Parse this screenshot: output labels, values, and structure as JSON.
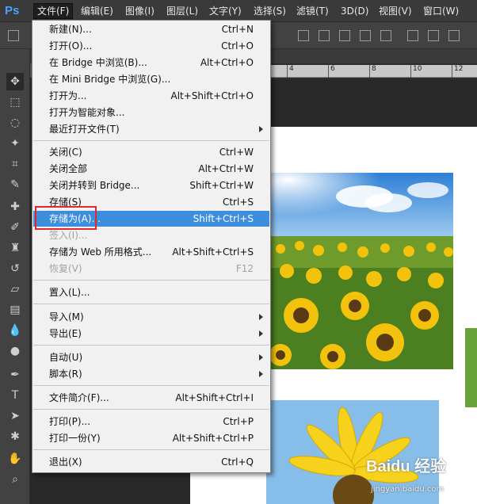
{
  "app": {
    "logo": "Ps"
  },
  "menubar": {
    "items": [
      {
        "label": "文件(F)",
        "active": true
      },
      {
        "label": "编辑(E)"
      },
      {
        "label": "图像(I)"
      },
      {
        "label": "图层(L)"
      },
      {
        "label": "文字(Y)"
      },
      {
        "label": "选择(S)"
      },
      {
        "label": "滤镜(T)"
      },
      {
        "label": "3D(D)"
      },
      {
        "label": "视图(V)"
      },
      {
        "label": "窗口(W)"
      }
    ]
  },
  "ruler": {
    "ticks": [
      "4",
      "6",
      "8",
      "10",
      "12"
    ]
  },
  "file_menu": {
    "items": [
      {
        "label": "新建(N)...",
        "shortcut": "Ctrl+N"
      },
      {
        "label": "打开(O)...",
        "shortcut": "Ctrl+O"
      },
      {
        "label": "在 Bridge 中浏览(B)...",
        "shortcut": "Alt+Ctrl+O"
      },
      {
        "label": "在 Mini Bridge 中浏览(G)...",
        "shortcut": ""
      },
      {
        "label": "打开为...",
        "shortcut": "Alt+Shift+Ctrl+O"
      },
      {
        "label": "打开为智能对象...",
        "shortcut": ""
      },
      {
        "label": "最近打开文件(T)",
        "shortcut": "",
        "submenu": true
      },
      {
        "label": "关闭(C)",
        "shortcut": "Ctrl+W"
      },
      {
        "label": "关闭全部",
        "shortcut": "Alt+Ctrl+W"
      },
      {
        "label": "关闭并转到 Bridge...",
        "shortcut": "Shift+Ctrl+W"
      },
      {
        "label": "存储(S)",
        "shortcut": "Ctrl+S"
      },
      {
        "label": "存储为(A)...",
        "shortcut": "Shift+Ctrl+S",
        "highlighted": true
      },
      {
        "label": "签入(I)...",
        "shortcut": "",
        "disabled": true
      },
      {
        "label": "存储为 Web 所用格式...",
        "shortcut": "Alt+Shift+Ctrl+S"
      },
      {
        "label": "恢复(V)",
        "shortcut": "F12",
        "disabled": true
      },
      {
        "label": "置入(L)...",
        "shortcut": ""
      },
      {
        "label": "导入(M)",
        "shortcut": "",
        "submenu": true
      },
      {
        "label": "导出(E)",
        "shortcut": "",
        "submenu": true
      },
      {
        "label": "自动(U)",
        "shortcut": "",
        "submenu": true
      },
      {
        "label": "脚本(R)",
        "shortcut": "",
        "submenu": true
      },
      {
        "label": "文件简介(F)...",
        "shortcut": "Alt+Shift+Ctrl+I"
      },
      {
        "label": "打印(P)...",
        "shortcut": "Ctrl+P"
      },
      {
        "label": "打印一份(Y)",
        "shortcut": "Alt+Shift+Ctrl+P"
      },
      {
        "label": "退出(X)",
        "shortcut": "Ctrl+Q"
      }
    ]
  },
  "watermark": {
    "brand": "Baidu 经验",
    "url": "jingyan.baidu.com"
  },
  "colors": {
    "highlight": "#3e8ede",
    "annotation": "#e0282e",
    "ps_blue": "#4aa3ff"
  }
}
